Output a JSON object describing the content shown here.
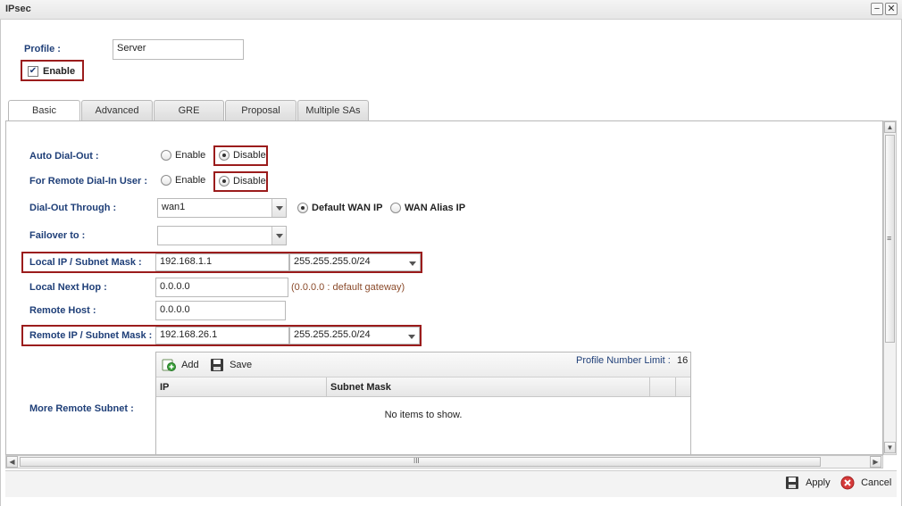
{
  "window": {
    "title": "IPsec",
    "minimize_label": "−",
    "close_label": "✕"
  },
  "profile": {
    "label": "Profile :",
    "value": "Server",
    "enable_label": "Enable",
    "enable_checked": true
  },
  "tabs": [
    {
      "label": "Basic",
      "active": true
    },
    {
      "label": "Advanced",
      "active": false
    },
    {
      "label": "GRE",
      "active": false
    },
    {
      "label": "Proposal",
      "active": false
    },
    {
      "label": "Multiple SAs",
      "active": false
    }
  ],
  "basic": {
    "auto_dial_out": {
      "label": "Auto Dial-Out :",
      "enable_label": "Enable",
      "disable_label": "Disable",
      "selected": "Disable"
    },
    "remote_dial_in": {
      "label": "For Remote Dial-In User :",
      "enable_label": "Enable",
      "disable_label": "Disable",
      "selected": "Disable"
    },
    "dial_out_through": {
      "label": "Dial-Out Through :",
      "value": "wan1",
      "default_wan_ip_label": "Default WAN IP",
      "wan_alias_ip_label": "WAN Alias IP",
      "selected": "Default WAN IP"
    },
    "failover_to": {
      "label": "Failover to :",
      "value": ""
    },
    "local_ip": {
      "label": "Local IP / Subnet Mask :",
      "ip": "192.168.1.1",
      "mask": "255.255.255.0/24"
    },
    "local_next_hop": {
      "label": "Local Next Hop :",
      "value": "0.0.0.0",
      "hint": "(0.0.0.0 : default gateway)"
    },
    "remote_host": {
      "label": "Remote Host :",
      "value": "0.0.0.0"
    },
    "remote_ip": {
      "label": "Remote IP / Subnet Mask :",
      "ip": "192.168.26.1",
      "mask": "255.255.255.0/24"
    },
    "more_remote_subnet": {
      "label": "More Remote Subnet :",
      "add_label": "Add",
      "save_label": "Save",
      "limit_label": "Profile Number Limit :",
      "limit_value": "16",
      "columns": [
        "IP",
        "Subnet Mask"
      ],
      "empty_text": "No items to show."
    }
  },
  "footer": {
    "apply_label": "Apply",
    "cancel_label": "Cancel"
  },
  "colors": {
    "label_blue": "#1f3f78",
    "highlight_red": "#9b1c1c"
  },
  "hscroll_grip": "III",
  "vscroll_grip": "≡"
}
